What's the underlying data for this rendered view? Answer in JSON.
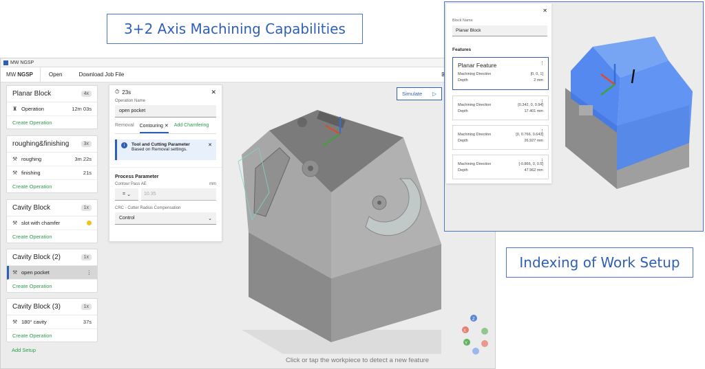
{
  "captions": {
    "top": "3+2 Axis Machining Capabilities",
    "bottom": "Indexing of Work Setup"
  },
  "app": {
    "window_title": "MW NGSP",
    "brand_prefix": "MW",
    "brand_name": "NGSP",
    "menu": [
      "Open",
      "Download Job File"
    ]
  },
  "sidebar": {
    "setups": [
      {
        "title": "Planar Block",
        "count": "4x",
        "ops": [
          {
            "name": "Operation",
            "time": "12m 03s",
            "icon": "face-mill-icon"
          }
        ],
        "create": "Create Operation"
      },
      {
        "title": "roughing&finishing",
        "count": "3x",
        "ops": [
          {
            "name": "roughing",
            "time": "3m 22s",
            "icon": "tool-icon"
          },
          {
            "name": "finishing",
            "time": "21s",
            "icon": "tool-icon"
          }
        ],
        "create": "Create Operation"
      },
      {
        "title": "Cavity Block",
        "count": "1x",
        "ops": [
          {
            "name": "slot with chamfer",
            "time": "",
            "icon": "tool-icon",
            "warning": true
          }
        ],
        "create": "Create Operation"
      },
      {
        "title": "Cavity Block (2)",
        "count": "1x",
        "ops": [
          {
            "name": "open pocket",
            "time": "",
            "icon": "tool-icon",
            "active": true
          }
        ],
        "create": "Create Operation"
      },
      {
        "title": "Cavity Block (3)",
        "count": "1x",
        "ops": [
          {
            "name": "180° cavity",
            "time": "37s",
            "icon": "tool-icon"
          }
        ],
        "create": "Create Operation"
      }
    ],
    "add_setup": "Add Setup"
  },
  "operation_panel": {
    "time": "23s",
    "name_label": "Operation Name",
    "name_value": "open pocket",
    "tabs": [
      "Removal",
      "Contouring",
      "Add Chamfering"
    ],
    "info_title": "Tool and Cutting Parameter",
    "info_text": "Based on Removal settings.",
    "section": "Process Parameter",
    "contour_label": "Contour Pass AE",
    "contour_unit": "mm",
    "contour_op": "=",
    "contour_value": "10.35",
    "crc_label": "CRC - Cutter Radius Compensation",
    "crc_value": "Control"
  },
  "viewport": {
    "simulate": "Simulate",
    "hint": "Click or tap the workpiece to detect a new feature",
    "axes": [
      "X",
      "Y",
      "Z"
    ]
  },
  "inset": {
    "block_name_label": "Block Name",
    "block_name_value": "Planar Block",
    "features_label": "Features",
    "features": [
      {
        "title": "Planar Feature",
        "dir_label": "Machining Direction",
        "dir": "[0, 0, 1]",
        "depth_label": "Depth",
        "depth": "2 mm"
      },
      {
        "dir_label": "Machining Direction",
        "dir": "[0.342, 0, 0.94]",
        "depth_label": "Depth",
        "depth": "17.401 mm"
      },
      {
        "dir_label": "Machining Direction",
        "dir": "[0, 0.766, 0.643]",
        "depth_label": "Depth",
        "depth": "26.927 mm"
      },
      {
        "dir_label": "Machining Direction",
        "dir": "[-0.866, 0, 0.5]",
        "depth_label": "Depth",
        "depth": "47.962 mm"
      }
    ]
  },
  "colors": {
    "accent": "#2f5fb5",
    "link": "#2e9a4b",
    "part_gray": "#8c8c8c",
    "highlight_blue": "#3b78f0"
  }
}
